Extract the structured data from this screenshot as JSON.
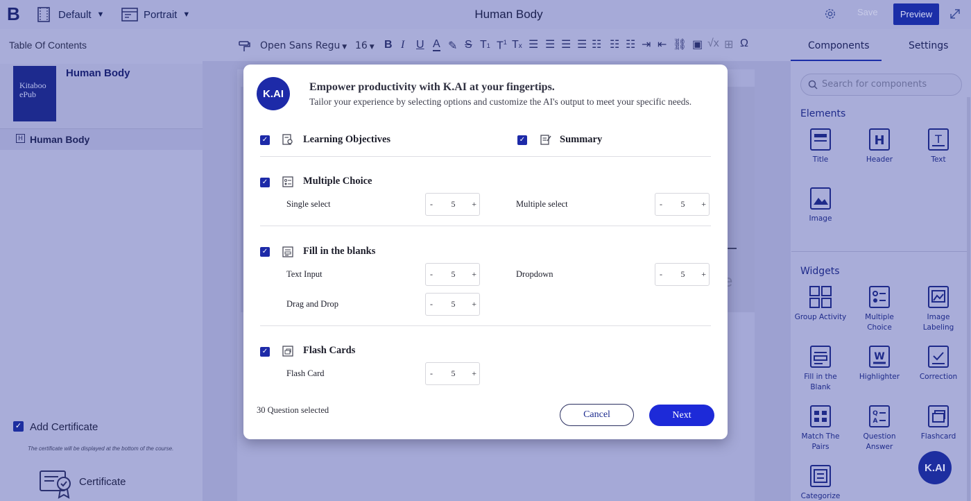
{
  "topbar": {
    "logo": "B",
    "layout_label": "Default",
    "orientation_label": "Portrait",
    "document_title": "Human Body",
    "save_label": "Save",
    "preview_label": "Preview"
  },
  "left_panel": {
    "title": "Table Of Contents",
    "cover_text": "Kitaboo ePub",
    "book_title": "Human Body",
    "toc_items": [
      {
        "tag": "H",
        "label": "Human Body"
      }
    ],
    "add_certificate_label": "Add Certificate",
    "add_certificate_checked": true,
    "certificate_note": "The certificate will be displayed at the bottom of the course.",
    "certificate_label": "Certificate"
  },
  "toolbar": {
    "font_name": "Open Sans Regu",
    "font_size": "16"
  },
  "right_panel": {
    "tabs": [
      "Components",
      "Settings"
    ],
    "active_tab": "Components",
    "search_placeholder": "Search for components",
    "elements_heading": "Elements",
    "elements": [
      {
        "label": "Title",
        "icon": "title-icon"
      },
      {
        "label": "Header",
        "icon": "header-icon"
      },
      {
        "label": "Text",
        "icon": "text-icon"
      },
      {
        "label": "Image",
        "icon": "image-icon"
      }
    ],
    "widgets_heading": "Widgets",
    "widgets": [
      {
        "label": "Group Activity",
        "icon": "group-activity-icon"
      },
      {
        "label": "Multiple Choice",
        "icon": "multiple-choice-icon"
      },
      {
        "label": "Image Labeling",
        "icon": "image-labeling-icon"
      },
      {
        "label": "Fill in the Blank",
        "icon": "fill-blank-icon"
      },
      {
        "label": "Highlighter",
        "icon": "highlighter-icon"
      },
      {
        "label": "Correction",
        "icon": "correction-icon"
      },
      {
        "label": "Match The Pairs",
        "icon": "match-pairs-icon"
      },
      {
        "label": "Question Answer",
        "icon": "question-answer-icon"
      },
      {
        "label": "Flashcard",
        "icon": "flashcard-icon"
      },
      {
        "label": "Categorize",
        "icon": "categorize-icon"
      }
    ],
    "kai_fab": "K.AI"
  },
  "modal": {
    "badge": "K.AI",
    "title": "Empower productivity with K.AI at your fingertips.",
    "subtitle": "Tailor your experience by selecting options and customize the AI's output to meet your specific needs.",
    "learning_objectives": {
      "label": "Learning Objectives",
      "checked": true
    },
    "summary": {
      "label": "Summary",
      "checked": true
    },
    "multiple_choice": {
      "label": "Multiple Choice",
      "checked": true,
      "single_select": {
        "label": "Single select",
        "value": "5"
      },
      "multiple_select": {
        "label": "Multiple select",
        "value": "5"
      }
    },
    "fill_blanks": {
      "label": "Fill in the blanks",
      "checked": true,
      "text_input": {
        "label": "Text Input",
        "value": "5"
      },
      "dropdown": {
        "label": "Dropdown",
        "value": "5"
      },
      "drag_drop": {
        "label": "Drag and Drop",
        "value": "5"
      }
    },
    "flash_cards": {
      "label": "Flash Cards",
      "checked": true,
      "flash_card": {
        "label": "Flash Card",
        "value": "5"
      }
    },
    "stepper_minus": "-",
    "stepper_plus": "+",
    "selected_count": "30 Question selected",
    "cancel_label": "Cancel",
    "next_label": "Next"
  }
}
